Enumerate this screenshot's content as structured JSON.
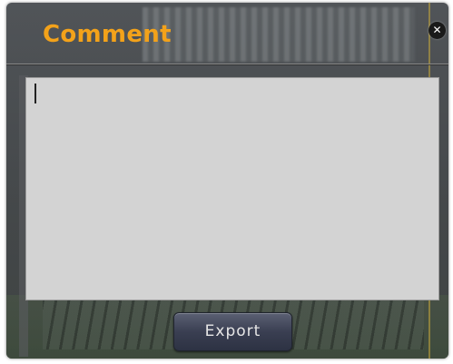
{
  "dialog": {
    "title": "Comment",
    "close_icon_glyph": "✕",
    "title_color": "#f3a21a",
    "comment": {
      "value": "",
      "placeholder": ""
    },
    "export_label": "Export"
  }
}
